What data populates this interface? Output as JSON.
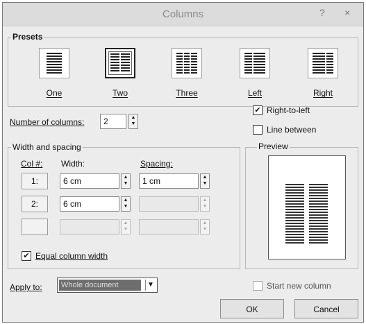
{
  "window": {
    "title": "Columns",
    "help": "?",
    "close": "×"
  },
  "presets": {
    "label": "Presets",
    "items": [
      {
        "label": "One"
      },
      {
        "label": "Two"
      },
      {
        "label": "Three"
      },
      {
        "label": "Left"
      },
      {
        "label": "Right"
      }
    ],
    "selected": "Two"
  },
  "number_of_columns": {
    "label": "Number of columns:",
    "value": "2"
  },
  "right_to_left": {
    "label": "Right-to-left",
    "checked": true
  },
  "line_between": {
    "label": "Line between",
    "checked": false
  },
  "width_spacing": {
    "label": "Width and spacing",
    "col_header": "Col #:",
    "width_header": "Width:",
    "spacing_header": "Spacing:",
    "rows": [
      {
        "col": "1:",
        "width": "6 cm",
        "spacing": "1 cm"
      },
      {
        "col": "2:",
        "width": "6 cm",
        "spacing": ""
      },
      {
        "col": "",
        "width": "",
        "spacing": ""
      }
    ]
  },
  "equal_column_width": {
    "label": "Equal column width",
    "checked": true
  },
  "preview": {
    "label": "Preview"
  },
  "apply_to": {
    "label": "Apply to:",
    "value": "Whole document"
  },
  "start_new_column": {
    "label": "Start new column",
    "checked": false
  },
  "buttons": {
    "ok": "OK",
    "cancel": "Cancel"
  },
  "icons": {
    "checked": "checkmark-icon",
    "spin": "spin-arrows-icon",
    "dropdown": "chevron-down-icon"
  }
}
